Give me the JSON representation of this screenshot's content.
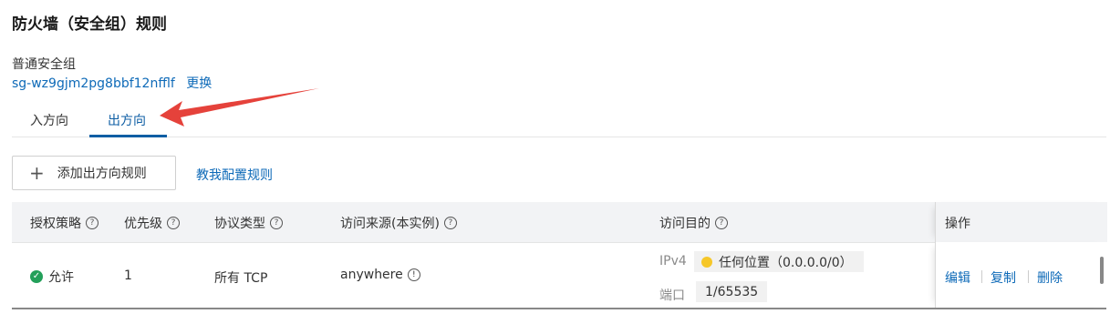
{
  "title": "防火墙（安全组）规则",
  "group": {
    "label": "普通安全组",
    "id": "sg-wz9gjm2pg8bbf12nfflf",
    "change": "更换"
  },
  "tabs": {
    "inbound": "入方向",
    "outbound": "出方向"
  },
  "toolbar": {
    "add": "添加出方向规则",
    "teach": "教我配置规则"
  },
  "columns": {
    "policy": "授权策略",
    "priority": "优先级",
    "protocol": "协议类型",
    "source": "访问来源(本实例)",
    "destination": "访问目的",
    "operations": "操作"
  },
  "row": {
    "policy": "允许",
    "priority": "1",
    "protocol": "所有 TCP",
    "source": "anywhere",
    "ipv4_label": "IPv4",
    "destination": "任何位置（0.0.0.0/0）",
    "port_label": "端口",
    "port": "1/65535"
  },
  "ops": {
    "edit": "编辑",
    "copy": "复制",
    "delete": "删除"
  },
  "colors": {
    "link": "#0e6ab8",
    "tab_active": "#0e5ea4",
    "allow": "#23a05a",
    "annotation_arrow": "#e5423b"
  }
}
